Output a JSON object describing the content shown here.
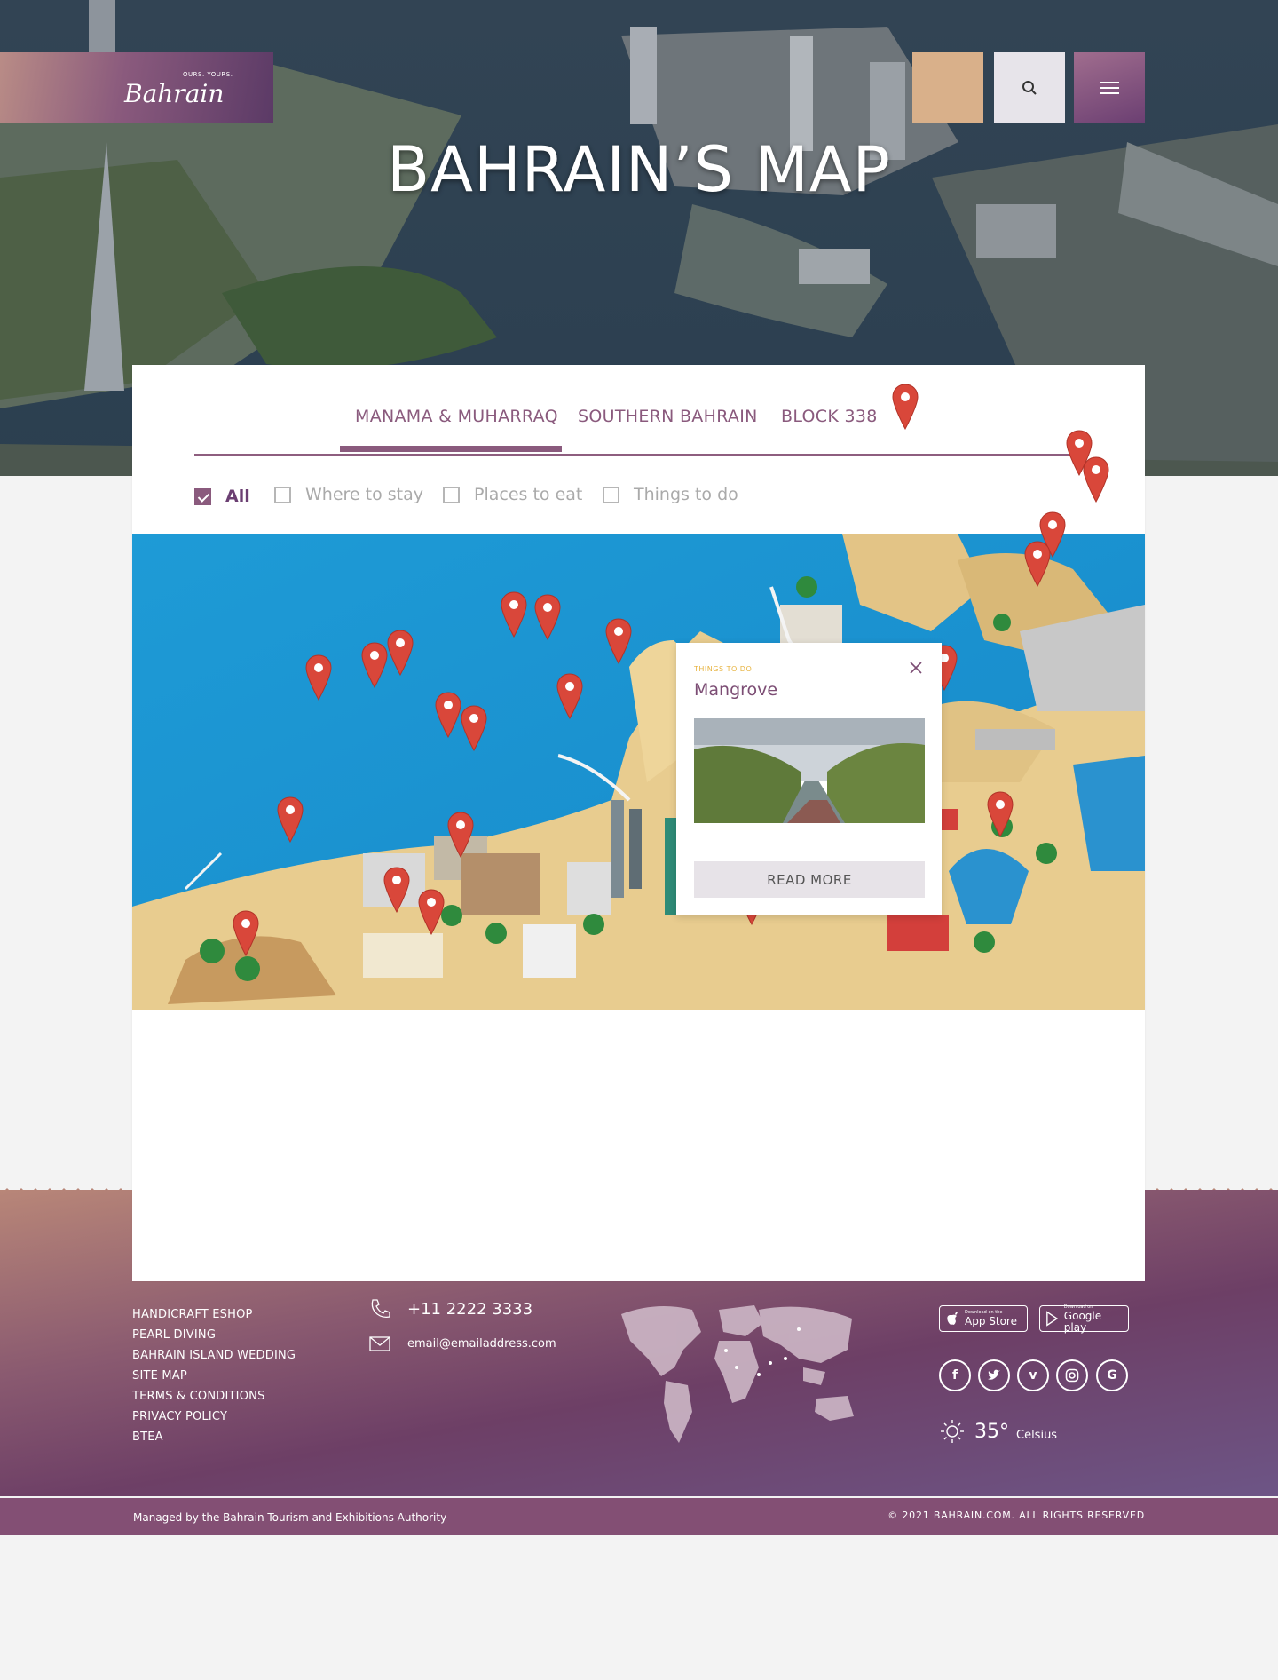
{
  "header": {
    "tagline": "OURS. YOURS.",
    "logo_word": "Bahrain",
    "title": "BAHRAIN’S MAP",
    "search_icon": "search-icon",
    "menu_icon": "hamburger-menu-icon"
  },
  "tabs": [
    {
      "label": "MANAMA & MUHARRAQ",
      "active": true
    },
    {
      "label": "SOUTHERN BAHRAIN",
      "active": false
    },
    {
      "label": "BLOCK 338",
      "active": false
    }
  ],
  "filters": [
    {
      "label": "All",
      "checked": true
    },
    {
      "label": "Where to stay",
      "checked": false
    },
    {
      "label": "Places to eat",
      "checked": false
    },
    {
      "label": "Things to do",
      "checked": false
    }
  ],
  "popup": {
    "category": "THINGS TO DO",
    "title": "Mangrove",
    "button": "READ MORE"
  },
  "footer": {
    "links": [
      "HANDICRAFT ESHOP",
      "PEARL DIVING",
      "BAHRAIN ISLAND WEDDING",
      "SITE MAP",
      "TERMS & CONDITIONS",
      "PRIVACY POLICY",
      "BTEA"
    ],
    "phone": "+11 2222 3333",
    "email": "email@emailaddress.com",
    "app_store": {
      "small": "Download on the",
      "big": "App Store"
    },
    "google_play": {
      "small": "Download on",
      "big": "Google play"
    },
    "social": [
      "facebook-icon",
      "twitter-icon",
      "vimeo-icon",
      "instagram-icon",
      "google-icon"
    ],
    "weather": {
      "temp": "35°",
      "unit": "Celsius"
    },
    "managed_by": "Managed by the Bahrain Tourism and Exhibitions Authority",
    "copyright": "© 2021 BAHRAIN.COM. ALL RIGHTS RESERVED"
  },
  "colors": {
    "brand_purple": "#8a5a7d",
    "gold": "#d9b08a",
    "pin_red": "#d9473a",
    "accent_yellow": "#e7b33f"
  }
}
